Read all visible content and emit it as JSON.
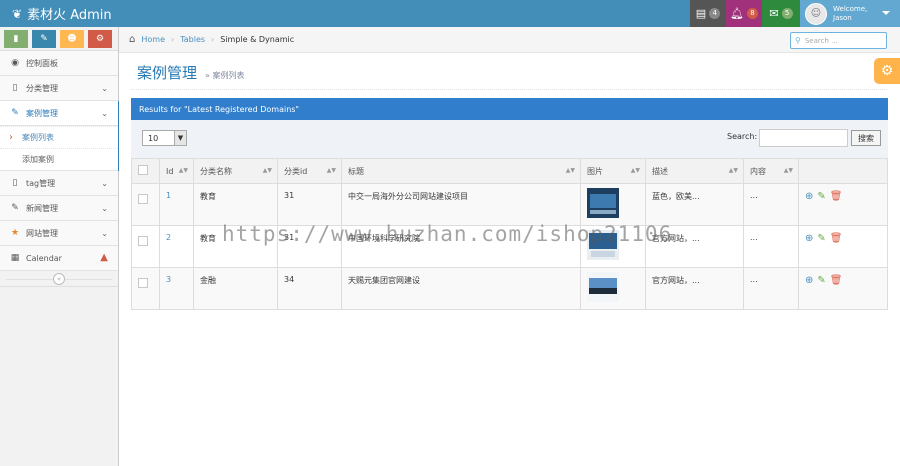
{
  "navbar": {
    "brand": "素材火 Admin",
    "tasks_badge": "4",
    "notifications_badge": "8",
    "messages_badge": "5",
    "welcome": "Welcome,",
    "username": "Jason"
  },
  "sidebar": {
    "items": [
      {
        "label": "控制面板"
      },
      {
        "label": "分类管理"
      },
      {
        "label": "案例管理"
      },
      {
        "label": "tag管理"
      },
      {
        "label": "新闻管理"
      },
      {
        "label": "网站管理"
      },
      {
        "label": "Calendar"
      }
    ],
    "submenu": [
      {
        "label": "案例列表"
      },
      {
        "label": "添加案例"
      }
    ]
  },
  "breadcrumb": {
    "home": "Home",
    "tables": "Tables",
    "current": "Simple & Dynamic"
  },
  "search": {
    "placeholder": "Search ..."
  },
  "page": {
    "title": "案例管理",
    "subtitle": "» 案例列表"
  },
  "table": {
    "header": "Results for \"Latest Registered Domains\"",
    "length_value": "10",
    "search_label": "Search:",
    "search_button": "搜索",
    "columns": [
      "Id",
      "分类名称",
      "分类id",
      "标题",
      "图片",
      "描述",
      "内容"
    ],
    "rows": [
      {
        "id": "1",
        "category": "教育",
        "category_id": "31",
        "title": "中交一局海外分公司网站建设项目",
        "desc": "蓝色，欧美...",
        "content": "..."
      },
      {
        "id": "2",
        "category": "教育",
        "category_id": "31",
        "title": "中国环境科学研究院",
        "desc": "官方网站，...",
        "content": "..."
      },
      {
        "id": "3",
        "category": "金融",
        "category_id": "34",
        "title": "天赐元集团官网建设",
        "desc": "官方网站，...",
        "content": "..."
      }
    ]
  },
  "watermark": "https://www.huzhan.com/ishop21106",
  "colors": {
    "navbar": "#438eb9",
    "accent": "#307ecc",
    "settings": "#ffb44b"
  }
}
